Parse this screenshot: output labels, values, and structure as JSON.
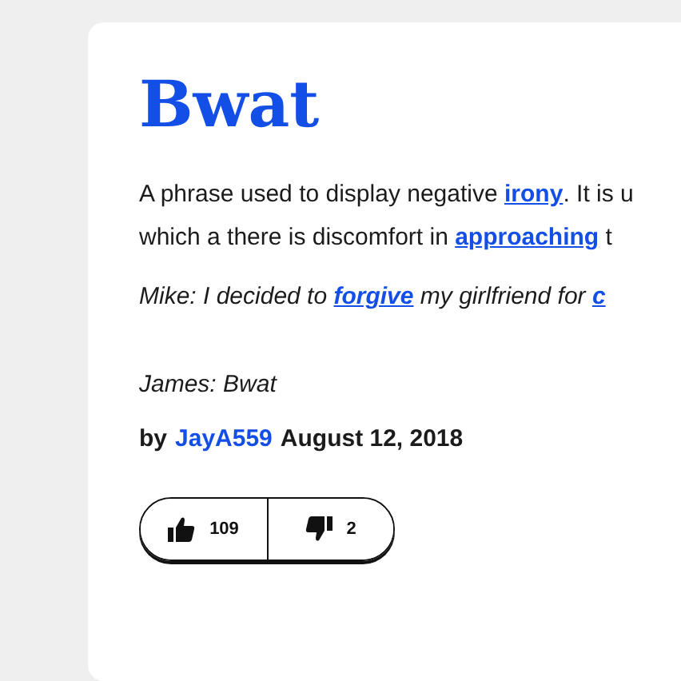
{
  "entry": {
    "word": "Bwat",
    "definition": [
      [
        {
          "text": "A phrase used to display negative ",
          "link": false
        },
        {
          "text": "irony",
          "link": true
        },
        {
          "text": ". It is u",
          "link": false
        }
      ],
      [
        {
          "text": "which a there is discomfort in ",
          "link": false
        },
        {
          "text": "approaching",
          "link": true
        },
        {
          "text": " t",
          "link": false
        }
      ]
    ],
    "example": [
      [
        {
          "text": "Mike: I decided to ",
          "link": false
        },
        {
          "text": "forgive",
          "link": true
        },
        {
          "text": " my girlfriend for ",
          "link": false
        },
        {
          "text": "c",
          "link": true
        }
      ],
      [
        {
          "text": "James: Bwat",
          "link": false
        }
      ]
    ],
    "byline": {
      "prefix": "by",
      "author": "JayA559",
      "date": "August 12, 2018"
    },
    "votes": {
      "up": "109",
      "down": "2"
    }
  }
}
